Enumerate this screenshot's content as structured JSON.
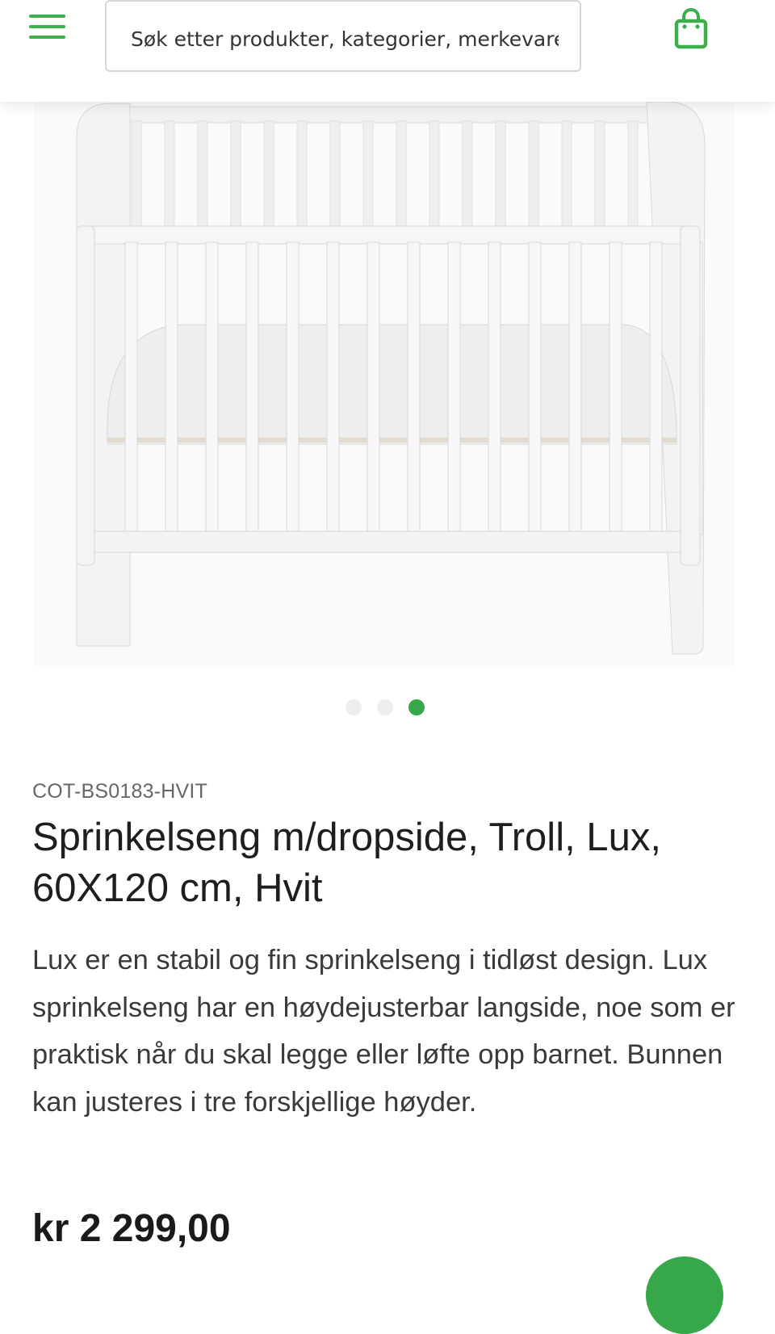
{
  "header": {
    "search_placeholder": "Søk etter produkter, kategorier, merkevarer",
    "accent_color": "#3cae4b",
    "icons": [
      "hamburger-menu-icon",
      "shopping-bag-icon"
    ]
  },
  "gallery": {
    "image": "white-crib-with-mattress",
    "slide_count": 3,
    "active_slide": 3
  },
  "product": {
    "sku": "COT-BS0183-HVIT",
    "title": "Sprinkelseng m/dropside, Troll, Lux, 60X120 cm, Hvit",
    "description": "Lux er en stabil og fin sprinkelseng i tidløst design. Lux sprinkelseng har en høydejusterbar langside, noe som er praktisk når du skal legge eller løfte opp barnet. Bunnen kan justeres i tre forskjellige høyder.",
    "price": "kr 2 299,00"
  }
}
